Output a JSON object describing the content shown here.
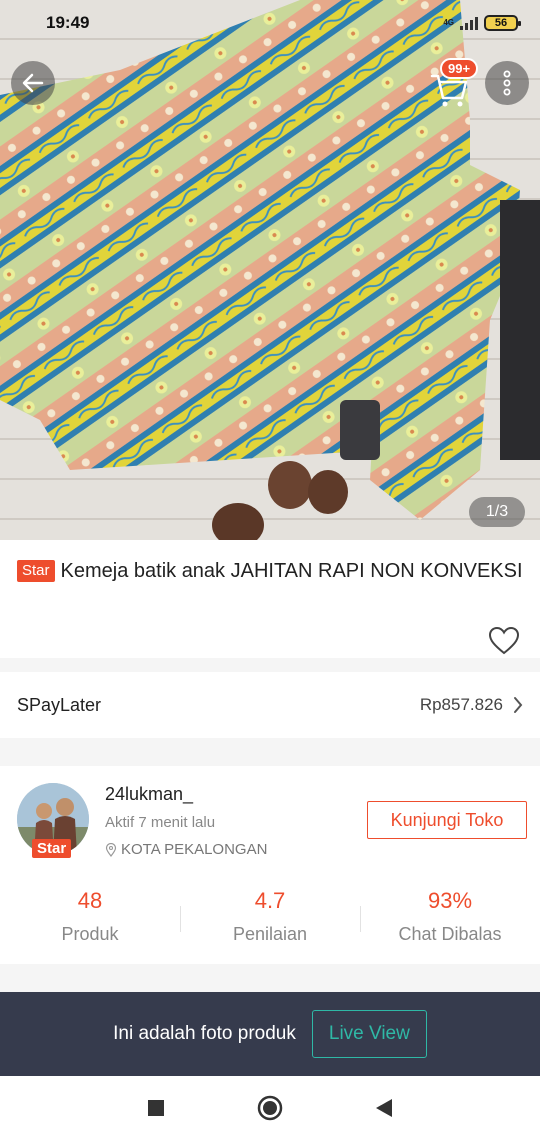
{
  "status_bar": {
    "time": "19:49",
    "network": "4G",
    "battery": "56"
  },
  "header": {
    "cart_badge": "99+",
    "icons": [
      "back-arrow-icon",
      "cart-icon",
      "more-vertical-icon"
    ]
  },
  "gallery": {
    "counter": "1/3"
  },
  "product": {
    "badge": "Star",
    "title": "Kemeja batik anak JAHITAN RAPI NON KONVEKSI"
  },
  "spaylater": {
    "label": "SPayLater",
    "amount": "Rp857.826"
  },
  "shop": {
    "name": "24lukman_",
    "active": "Aktif 7 menit lalu",
    "location": "KOTA PEKALONGAN",
    "badge": "Star",
    "visit_label": "Kunjungi Toko",
    "stats": [
      {
        "value": "48",
        "label": "Produk"
      },
      {
        "value": "4.7",
        "label": "Penilaian"
      },
      {
        "value": "93%",
        "label": "Chat Dibalas"
      }
    ]
  },
  "banner": {
    "text": "Ini adalah foto produk",
    "button": "Live View"
  },
  "colors": {
    "accent": "#ee4d2d",
    "banner_bg": "#363b4d",
    "live_teal": "#2fb8a6"
  }
}
